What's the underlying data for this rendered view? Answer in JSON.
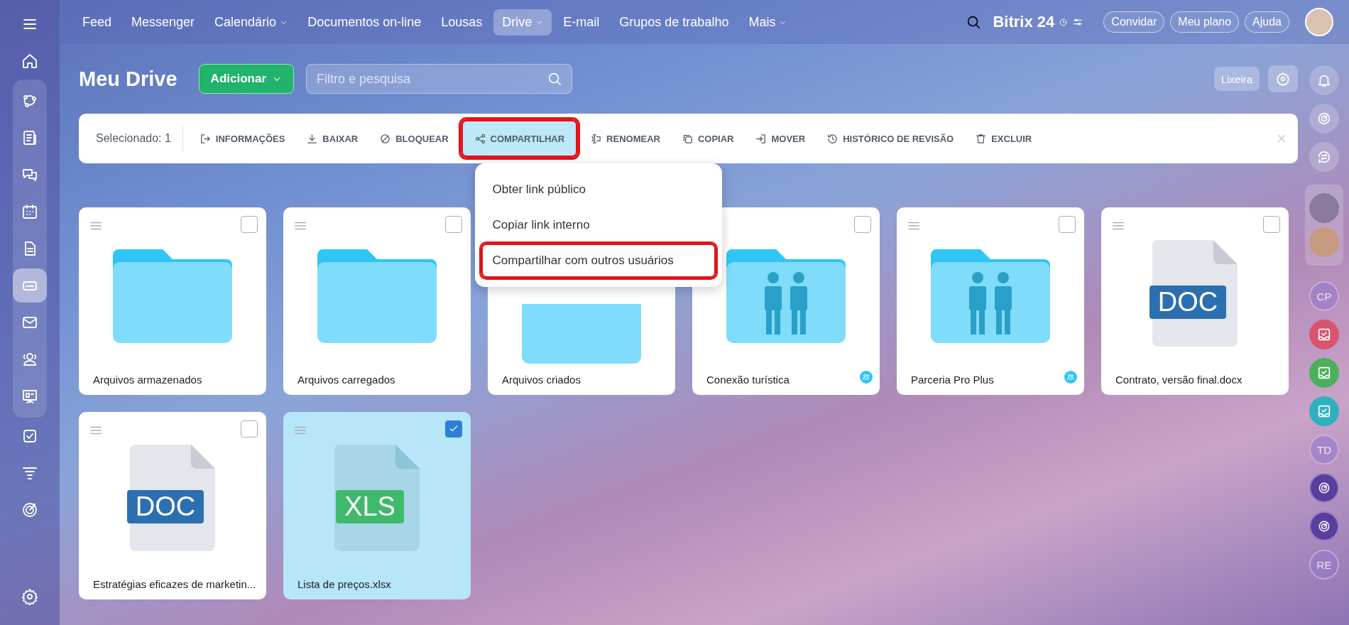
{
  "top_nav": {
    "items": [
      {
        "label": "Feed",
        "dropdown": false,
        "selected": false
      },
      {
        "label": "Messenger",
        "dropdown": false,
        "selected": false
      },
      {
        "label": "Calendário",
        "dropdown": true,
        "selected": false
      },
      {
        "label": "Documentos on-line",
        "dropdown": false,
        "selected": false
      },
      {
        "label": "Lousas",
        "dropdown": false,
        "selected": false
      },
      {
        "label": "Drive",
        "dropdown": true,
        "selected": true
      },
      {
        "label": "E-mail",
        "dropdown": false,
        "selected": false
      },
      {
        "label": "Grupos de trabalho",
        "dropdown": false,
        "selected": false
      },
      {
        "label": "Mais",
        "dropdown": true,
        "selected": false
      }
    ],
    "logo": {
      "text": "Bitrix",
      "number": "24"
    },
    "buttons": [
      "Convidar",
      "Meu plano",
      "Ajuda"
    ]
  },
  "left_nav": [
    {
      "selected": false
    },
    {
      "selected": false
    },
    {
      "selected": false
    },
    {
      "selected": false
    },
    {
      "selected": false
    },
    {
      "selected": false
    },
    {
      "selected": true
    },
    {
      "selected": false
    },
    {
      "selected": false
    },
    {
      "selected": false
    },
    {
      "selected": false
    },
    {
      "selected": false
    },
    {
      "selected": false
    },
    {
      "selected": false
    }
  ],
  "header": {
    "title": "Meu Drive",
    "add_button": "Adicionar",
    "search": {
      "placeholder": "Filtro e pesquisa"
    },
    "trash_button": "Lixeira"
  },
  "toolbar": {
    "selected_count": "Selecionado: 1",
    "actions": [
      {
        "label": "INFORMAÇÕES",
        "selected": false
      },
      {
        "label": "BAIXAR",
        "selected": false
      },
      {
        "label": "BLOQUEAR",
        "selected": false
      },
      {
        "label": "COMPARTILHAR",
        "selected": true,
        "highlighted": true
      },
      {
        "label": "RENOMEAR",
        "selected": false
      },
      {
        "label": "COPIAR",
        "selected": false
      },
      {
        "label": "MOVER",
        "selected": false
      },
      {
        "label": "HISTÓRICO DE REVISÃO",
        "selected": false
      },
      {
        "label": "EXCLUIR",
        "selected": false
      }
    ]
  },
  "share_menu": {
    "items": [
      {
        "label": "Obter link público",
        "highlighted": false
      },
      {
        "label": "Copiar link interno",
        "highlighted": false
      },
      {
        "label": "Compartilhar com outros usuários",
        "highlighted": true
      }
    ]
  },
  "files": [
    {
      "name": "Arquivos armazenados",
      "kind": "folder",
      "selected": false,
      "shared": false,
      "handle": true
    },
    {
      "name": "Arquivos carregados",
      "kind": "folder",
      "selected": false,
      "shared": false,
      "handle": true
    },
    {
      "name": "Arquivos criados",
      "kind": "folder",
      "shared": false,
      "handle": false
    },
    {
      "name": "Conexão turística",
      "kind": "shared-folder",
      "selected": false,
      "shared": true,
      "handle": false
    },
    {
      "name": "Parceria Pro Plus",
      "kind": "shared-folder",
      "selected": false,
      "shared": true,
      "handle": true
    },
    {
      "name": "Contrato, versão final.docx",
      "kind": "doc",
      "badge": "DOC",
      "selected": false,
      "shared": false,
      "handle": true
    },
    {
      "name": "Estratégias eficazes de marketin...",
      "kind": "doc",
      "badge": "DOC",
      "selected": false,
      "shared": false,
      "handle": true
    },
    {
      "name": "Lista de preços.xlsx",
      "kind": "xls",
      "badge": "XLS",
      "selected": true,
      "shared": false,
      "handle": true
    }
  ],
  "right_sidebar": [
    {
      "kind": "icon"
    },
    {
      "kind": "icon"
    },
    {
      "kind": "icon"
    },
    {
      "kind": "avatar"
    },
    {
      "kind": "avatar"
    },
    {
      "kind": "initials",
      "label": "CP"
    },
    {
      "kind": "app",
      "color": "#d9556f"
    },
    {
      "kind": "app",
      "color": "#4caf5c"
    },
    {
      "kind": "app",
      "color": "#2fb0be"
    },
    {
      "kind": "initials",
      "label": "TD"
    },
    {
      "kind": "channel"
    },
    {
      "kind": "channel"
    },
    {
      "kind": "initials",
      "label": "RE"
    }
  ]
}
